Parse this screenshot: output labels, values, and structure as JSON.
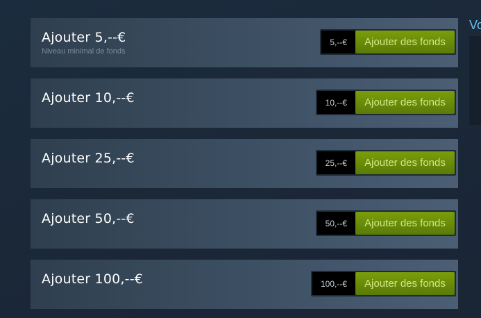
{
  "rows": [
    {
      "title": "Ajouter 5,--€",
      "subtitle": "Niveau minimal de fonds",
      "price": "5,--€",
      "button": "Ajouter des fonds"
    },
    {
      "title": "Ajouter 10,--€",
      "price": "10,--€",
      "button": "Ajouter des fonds"
    },
    {
      "title": "Ajouter 25,--€",
      "price": "25,--€",
      "button": "Ajouter des fonds"
    },
    {
      "title": "Ajouter 50,--€",
      "price": "50,--€",
      "button": "Ajouter des fonds"
    },
    {
      "title": "Ajouter 100,--€",
      "price": "100,--€",
      "button": "Ajouter des fonds"
    }
  ],
  "side": {
    "title": "Vo"
  }
}
